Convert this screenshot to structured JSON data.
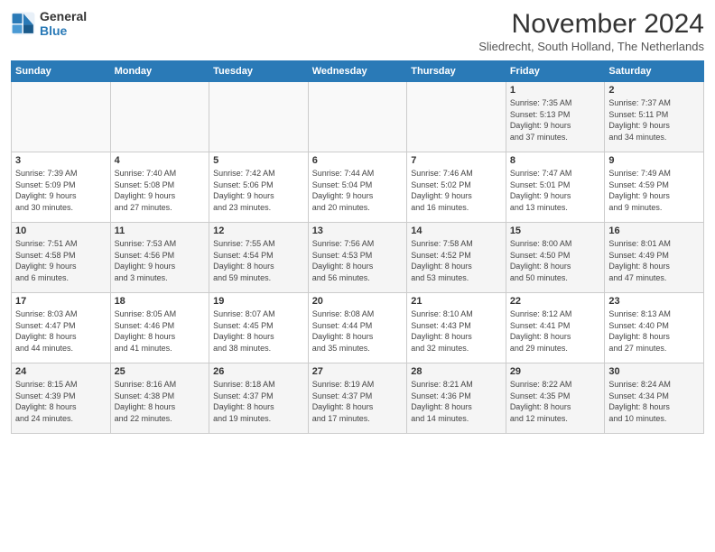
{
  "header": {
    "logo": {
      "general": "General",
      "blue": "Blue"
    },
    "title": "November 2024",
    "subtitle": "Sliedrecht, South Holland, The Netherlands"
  },
  "weekdays": [
    "Sunday",
    "Monday",
    "Tuesday",
    "Wednesday",
    "Thursday",
    "Friday",
    "Saturday"
  ],
  "weeks": [
    [
      {
        "day": "",
        "info": ""
      },
      {
        "day": "",
        "info": ""
      },
      {
        "day": "",
        "info": ""
      },
      {
        "day": "",
        "info": ""
      },
      {
        "day": "",
        "info": ""
      },
      {
        "day": "1",
        "info": "Sunrise: 7:35 AM\nSunset: 5:13 PM\nDaylight: 9 hours\nand 37 minutes."
      },
      {
        "day": "2",
        "info": "Sunrise: 7:37 AM\nSunset: 5:11 PM\nDaylight: 9 hours\nand 34 minutes."
      }
    ],
    [
      {
        "day": "3",
        "info": "Sunrise: 7:39 AM\nSunset: 5:09 PM\nDaylight: 9 hours\nand 30 minutes."
      },
      {
        "day": "4",
        "info": "Sunrise: 7:40 AM\nSunset: 5:08 PM\nDaylight: 9 hours\nand 27 minutes."
      },
      {
        "day": "5",
        "info": "Sunrise: 7:42 AM\nSunset: 5:06 PM\nDaylight: 9 hours\nand 23 minutes."
      },
      {
        "day": "6",
        "info": "Sunrise: 7:44 AM\nSunset: 5:04 PM\nDaylight: 9 hours\nand 20 minutes."
      },
      {
        "day": "7",
        "info": "Sunrise: 7:46 AM\nSunset: 5:02 PM\nDaylight: 9 hours\nand 16 minutes."
      },
      {
        "day": "8",
        "info": "Sunrise: 7:47 AM\nSunset: 5:01 PM\nDaylight: 9 hours\nand 13 minutes."
      },
      {
        "day": "9",
        "info": "Sunrise: 7:49 AM\nSunset: 4:59 PM\nDaylight: 9 hours\nand 9 minutes."
      }
    ],
    [
      {
        "day": "10",
        "info": "Sunrise: 7:51 AM\nSunset: 4:58 PM\nDaylight: 9 hours\nand 6 minutes."
      },
      {
        "day": "11",
        "info": "Sunrise: 7:53 AM\nSunset: 4:56 PM\nDaylight: 9 hours\nand 3 minutes."
      },
      {
        "day": "12",
        "info": "Sunrise: 7:55 AM\nSunset: 4:54 PM\nDaylight: 8 hours\nand 59 minutes."
      },
      {
        "day": "13",
        "info": "Sunrise: 7:56 AM\nSunset: 4:53 PM\nDaylight: 8 hours\nand 56 minutes."
      },
      {
        "day": "14",
        "info": "Sunrise: 7:58 AM\nSunset: 4:52 PM\nDaylight: 8 hours\nand 53 minutes."
      },
      {
        "day": "15",
        "info": "Sunrise: 8:00 AM\nSunset: 4:50 PM\nDaylight: 8 hours\nand 50 minutes."
      },
      {
        "day": "16",
        "info": "Sunrise: 8:01 AM\nSunset: 4:49 PM\nDaylight: 8 hours\nand 47 minutes."
      }
    ],
    [
      {
        "day": "17",
        "info": "Sunrise: 8:03 AM\nSunset: 4:47 PM\nDaylight: 8 hours\nand 44 minutes."
      },
      {
        "day": "18",
        "info": "Sunrise: 8:05 AM\nSunset: 4:46 PM\nDaylight: 8 hours\nand 41 minutes."
      },
      {
        "day": "19",
        "info": "Sunrise: 8:07 AM\nSunset: 4:45 PM\nDaylight: 8 hours\nand 38 minutes."
      },
      {
        "day": "20",
        "info": "Sunrise: 8:08 AM\nSunset: 4:44 PM\nDaylight: 8 hours\nand 35 minutes."
      },
      {
        "day": "21",
        "info": "Sunrise: 8:10 AM\nSunset: 4:43 PM\nDaylight: 8 hours\nand 32 minutes."
      },
      {
        "day": "22",
        "info": "Sunrise: 8:12 AM\nSunset: 4:41 PM\nDaylight: 8 hours\nand 29 minutes."
      },
      {
        "day": "23",
        "info": "Sunrise: 8:13 AM\nSunset: 4:40 PM\nDaylight: 8 hours\nand 27 minutes."
      }
    ],
    [
      {
        "day": "24",
        "info": "Sunrise: 8:15 AM\nSunset: 4:39 PM\nDaylight: 8 hours\nand 24 minutes."
      },
      {
        "day": "25",
        "info": "Sunrise: 8:16 AM\nSunset: 4:38 PM\nDaylight: 8 hours\nand 22 minutes."
      },
      {
        "day": "26",
        "info": "Sunrise: 8:18 AM\nSunset: 4:37 PM\nDaylight: 8 hours\nand 19 minutes."
      },
      {
        "day": "27",
        "info": "Sunrise: 8:19 AM\nSunset: 4:37 PM\nDaylight: 8 hours\nand 17 minutes."
      },
      {
        "day": "28",
        "info": "Sunrise: 8:21 AM\nSunset: 4:36 PM\nDaylight: 8 hours\nand 14 minutes."
      },
      {
        "day": "29",
        "info": "Sunrise: 8:22 AM\nSunset: 4:35 PM\nDaylight: 8 hours\nand 12 minutes."
      },
      {
        "day": "30",
        "info": "Sunrise: 8:24 AM\nSunset: 4:34 PM\nDaylight: 8 hours\nand 10 minutes."
      }
    ]
  ]
}
